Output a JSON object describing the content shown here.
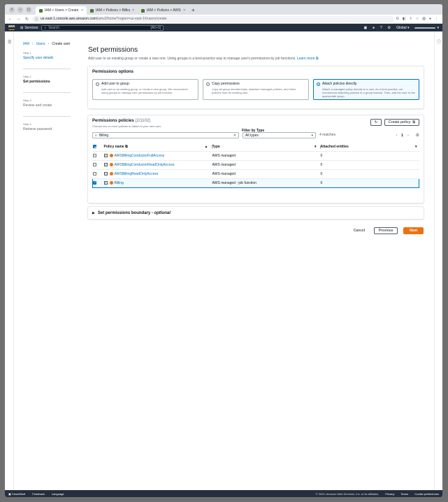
{
  "browser": {
    "tabs": [
      {
        "title": "IAM > Users > Create user",
        "active": true
      },
      {
        "title": "IAM > Policies > Billing",
        "active": false
      },
      {
        "title": "IAM > Policies > AWSBillin",
        "active": false
      }
    ],
    "url_host": "us-east-1.console.aws.amazon.com",
    "url_path": "/iamv2/home?region=us-east-1#/users/create"
  },
  "nav": {
    "logo": "aws",
    "services": "Services",
    "search_placeholder": "Search",
    "search_shortcut": "[Alt+S]",
    "region": "Global"
  },
  "breadcrumb": [
    "IAM",
    "Users",
    "Create user"
  ],
  "steps": [
    {
      "num": "Step 1",
      "label": "Specify user details"
    },
    {
      "num": "Step 2",
      "label": "Set permissions"
    },
    {
      "num": "Step 3",
      "label": "Review and create"
    },
    {
      "num": "Step 4",
      "label": "Retrieve password"
    }
  ],
  "page": {
    "title": "Set permissions",
    "description": "Add user to an existing group or create a new one. Using groups is a best-practice way to manage user's permissions by job functions.",
    "learn_more": "Learn more"
  },
  "permission_options": {
    "title": "Permissions options",
    "options": [
      {
        "title": "Add user to group",
        "text": "Add user to an existing group, or create a new group. We recommend using groups to manage user permissions by job function."
      },
      {
        "title": "Copy permissions",
        "text": "Copy all group memberships, attached managed policies, and inline policies from an existing user."
      },
      {
        "title": "Attach policies directly",
        "text": "Attach a managed policy directly to a user. As a best practice, we recommend attaching policies to a group instead. Then, add the user to the appropriate group."
      }
    ]
  },
  "policies": {
    "title": "Permissions policies",
    "count": "(2/1102)",
    "subtitle": "Choose one or more policies to attach to your new user.",
    "create_policy": "Create policy",
    "filter_label": "Filter by Type",
    "search_value": "Billing",
    "type_value": "All types",
    "matches": "4 matches",
    "page": "1",
    "columns": [
      "Policy name",
      "Type",
      "Attached entities"
    ],
    "rows": [
      {
        "name": "AWSBillingConductorFullAccess",
        "type": "AWS managed",
        "entities": "0"
      },
      {
        "name": "AWSBillingConductorReadOnlyAccess",
        "type": "AWS managed",
        "entities": "0"
      },
      {
        "name": "AWSBillingReadOnlyAccess",
        "type": "AWS managed",
        "entities": "0"
      },
      {
        "name": "Billing",
        "type": "AWS managed - job function",
        "entities": "0"
      }
    ]
  },
  "boundary": {
    "title": "Set permissions boundary - ",
    "optional": "optional"
  },
  "actions": {
    "cancel": "Cancel",
    "previous": "Previous",
    "next": "Next"
  },
  "footer": {
    "cloudshell": "CloudShell",
    "feedback": "Feedback",
    "language": "Language",
    "copyright": "© 2023, Amazon Web Services, Inc. or its affiliates.",
    "privacy": "Privacy",
    "terms": "Terms",
    "cookies": "Cookie preferences"
  },
  "colors": {
    "accent": "#0073bb",
    "primary": "#ec7211",
    "nav": "#232f3e"
  }
}
